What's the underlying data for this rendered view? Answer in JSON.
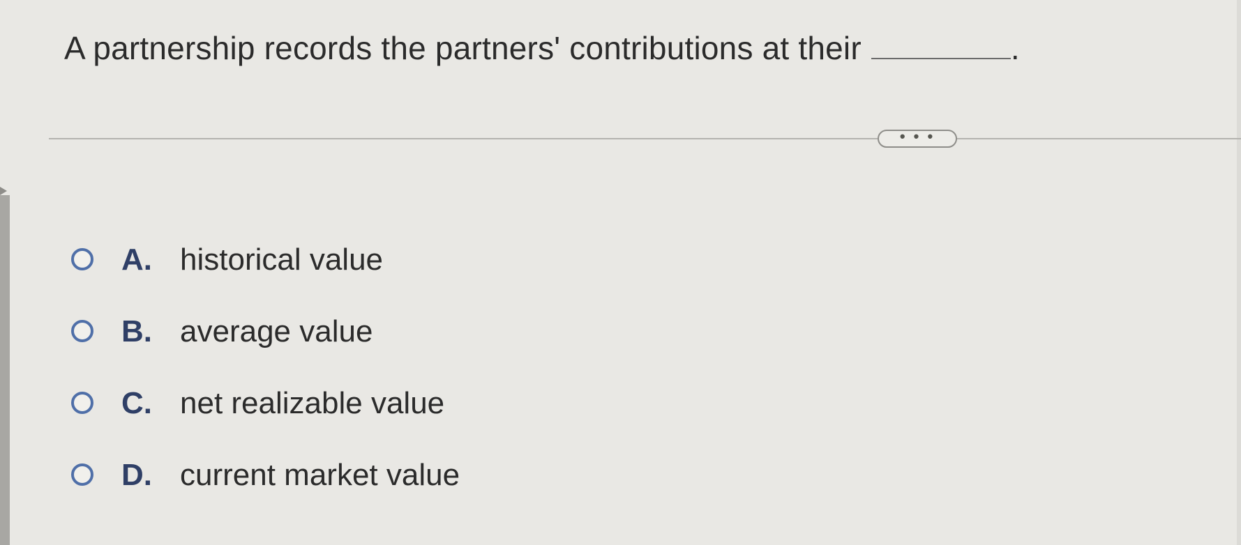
{
  "question": {
    "text": "A partnership records the partners' contributions at their",
    "end_punctuation": "."
  },
  "more_button": {
    "label": "• • •"
  },
  "options": [
    {
      "letter": "A.",
      "text": "historical value"
    },
    {
      "letter": "B.",
      "text": "average value"
    },
    {
      "letter": "C.",
      "text": "net realizable value"
    },
    {
      "letter": "D.",
      "text": "current market value"
    }
  ],
  "colors": {
    "background": "#e9e8e4",
    "radio_border": "#4f6fa8",
    "option_letter": "#2f3f66",
    "text": "#2b2b2b"
  }
}
